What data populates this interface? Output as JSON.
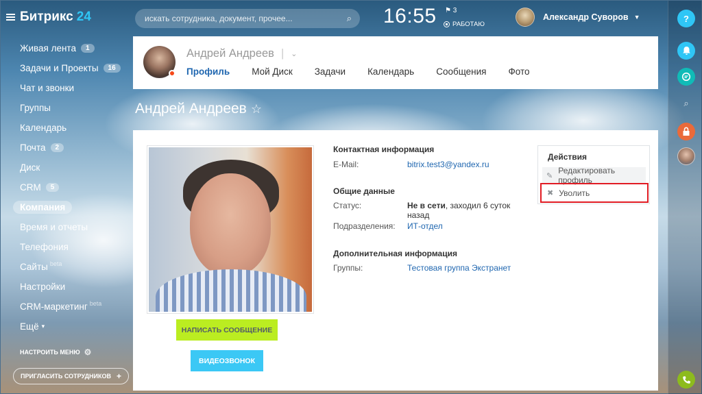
{
  "app": {
    "logo": "Битрикс",
    "logo_num": "24"
  },
  "sidebar": {
    "items": [
      {
        "label": "Живая лента",
        "counter": "1",
        "beta": ""
      },
      {
        "label": "Задачи и Проекты",
        "counter": "16",
        "beta": ""
      },
      {
        "label": "Чат и звонки",
        "counter": "",
        "beta": ""
      },
      {
        "label": "Группы",
        "counter": "",
        "beta": ""
      },
      {
        "label": "Календарь",
        "counter": "",
        "beta": ""
      },
      {
        "label": "Почта",
        "counter": "2",
        "beta": ""
      },
      {
        "label": "Диск",
        "counter": "",
        "beta": ""
      },
      {
        "label": "CRM",
        "counter": "5",
        "beta": ""
      },
      {
        "label": "Компания",
        "counter": "",
        "beta": ""
      },
      {
        "label": "Время и отчеты",
        "counter": "",
        "beta": ""
      },
      {
        "label": "Телефония",
        "counter": "",
        "beta": ""
      },
      {
        "label": "Сайты",
        "counter": "",
        "beta": "beta"
      },
      {
        "label": "Настройки",
        "counter": "",
        "beta": ""
      },
      {
        "label": "CRM-маркетинг",
        "counter": "",
        "beta": "beta"
      },
      {
        "label": "Ещё",
        "counter": "",
        "beta": ""
      }
    ],
    "active_item": "Компания",
    "more_caret": "▾",
    "setup_menu": "НАСТРОИТЬ МЕНЮ",
    "invite": "ПРИГЛАСИТЬ СОТРУДНИКОВ"
  },
  "topbar": {
    "search_placeholder": "искать сотрудника, документ, прочее...",
    "time": "16:55",
    "flag_count": "3",
    "work_status": "РАБОТАЮ",
    "user_name": "Александр Суворов"
  },
  "profile": {
    "name": "Андрей Андреев",
    "tabs": [
      {
        "label": "Профиль",
        "active": true
      },
      {
        "label": "Мой Диск",
        "active": false
      },
      {
        "label": "Задачи",
        "active": false
      },
      {
        "label": "Календарь",
        "active": false
      },
      {
        "label": "Сообщения",
        "active": false
      },
      {
        "label": "Фото",
        "active": false
      }
    ],
    "page_title": "Андрей Андреев",
    "buttons": {
      "message": "НАПИСАТЬ СООБЩЕНИЕ",
      "video": "ВИДЕОЗВОНОК"
    }
  },
  "info": {
    "contact_title": "Контактная информация",
    "email_label": "E-Mail:",
    "email_value": "bitrix.test3@yandex.ru",
    "general_title": "Общие данные",
    "status_label": "Статус:",
    "status_bold": "Не в сети",
    "status_rest": ", заходил 6 суток",
    "status_rest2": "назад",
    "dept_label": "Подразделения:",
    "dept_value": "ИТ-отдел",
    "extra_title": "Дополнительная информация",
    "groups_label": "Группы:",
    "groups_value": "Тестовая группа Экстранет"
  },
  "actions": {
    "title": "Действия",
    "edit": "Редактировать профиль",
    "fire": "Уволить"
  },
  "colors": {
    "accent_link": "#2067b0",
    "message_button": "#bbed21",
    "video_button": "#3bc8f5",
    "highlight": "#e11b23",
    "help": "#2fc6f6",
    "notifications": "#2fc6f6",
    "chat": "#10bbb7",
    "lock": "#ea6a3a",
    "phone": "#8dbb1d"
  },
  "right_panel": {
    "help": "?",
    "icons": [
      "help-icon",
      "bell-icon",
      "chat-icon",
      "search-icon",
      "lock-icon",
      "avatar",
      "phone-icon"
    ]
  }
}
